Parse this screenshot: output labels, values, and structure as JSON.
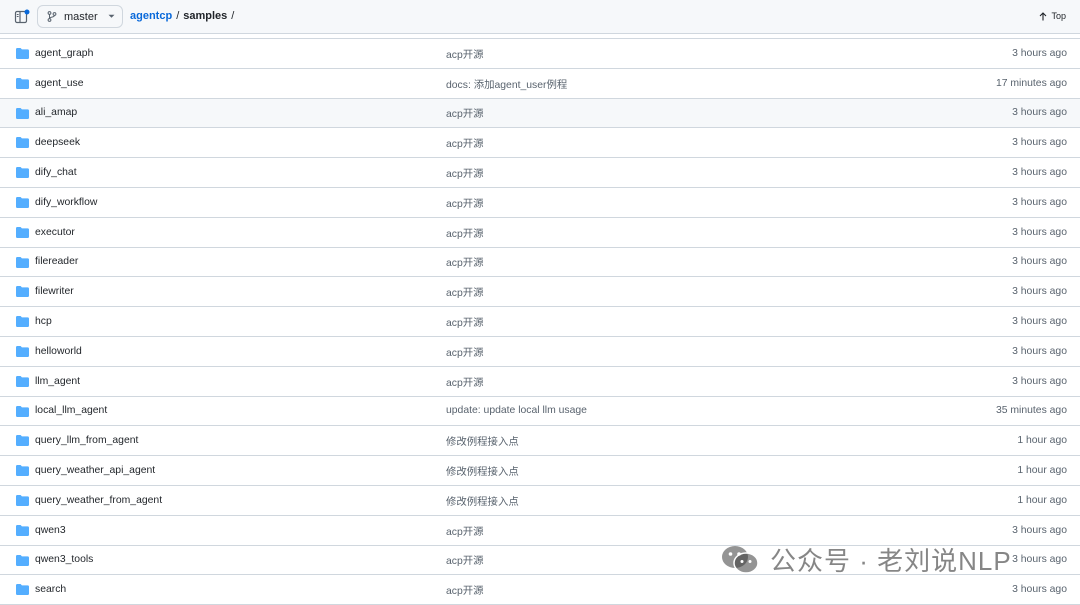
{
  "header": {
    "branch": "master",
    "breadcrumb_repo": "agentcp",
    "breadcrumb_sep1": "/",
    "breadcrumb_dir": "samples",
    "breadcrumb_sep2": "/",
    "top_label": "Top"
  },
  "colors": {
    "folder": "#54aeff",
    "link": "#0969da"
  },
  "files": [
    {
      "name": "agent_graph",
      "message": "acp开源",
      "age": "3 hours ago"
    },
    {
      "name": "agent_use",
      "message": "docs: 添加agent_user例程",
      "age": "17 minutes ago"
    },
    {
      "name": "ali_amap",
      "message": "acp开源",
      "age": "3 hours ago"
    },
    {
      "name": "deepseek",
      "message": "acp开源",
      "age": "3 hours ago"
    },
    {
      "name": "dify_chat",
      "message": "acp开源",
      "age": "3 hours ago"
    },
    {
      "name": "dify_workflow",
      "message": "acp开源",
      "age": "3 hours ago"
    },
    {
      "name": "executor",
      "message": "acp开源",
      "age": "3 hours ago"
    },
    {
      "name": "filereader",
      "message": "acp开源",
      "age": "3 hours ago"
    },
    {
      "name": "filewriter",
      "message": "acp开源",
      "age": "3 hours ago"
    },
    {
      "name": "hcp",
      "message": "acp开源",
      "age": "3 hours ago"
    },
    {
      "name": "helloworld",
      "message": "acp开源",
      "age": "3 hours ago"
    },
    {
      "name": "llm_agent",
      "message": "acp开源",
      "age": "3 hours ago"
    },
    {
      "name": "local_llm_agent",
      "message": "update: update local llm usage",
      "age": "35 minutes ago"
    },
    {
      "name": "query_llm_from_agent",
      "message": "修改例程接入点",
      "age": "1 hour ago"
    },
    {
      "name": "query_weather_api_agent",
      "message": "修改例程接入点",
      "age": "1 hour ago"
    },
    {
      "name": "query_weather_from_agent",
      "message": "修改例程接入点",
      "age": "1 hour ago"
    },
    {
      "name": "qwen3",
      "message": "acp开源",
      "age": "3 hours ago"
    },
    {
      "name": "qwen3_tools",
      "message": "acp开源",
      "age": "3 hours ago"
    },
    {
      "name": "search",
      "message": "acp开源",
      "age": "3 hours ago"
    }
  ],
  "watermark": {
    "text": "公众号 · 老刘说NLP"
  }
}
